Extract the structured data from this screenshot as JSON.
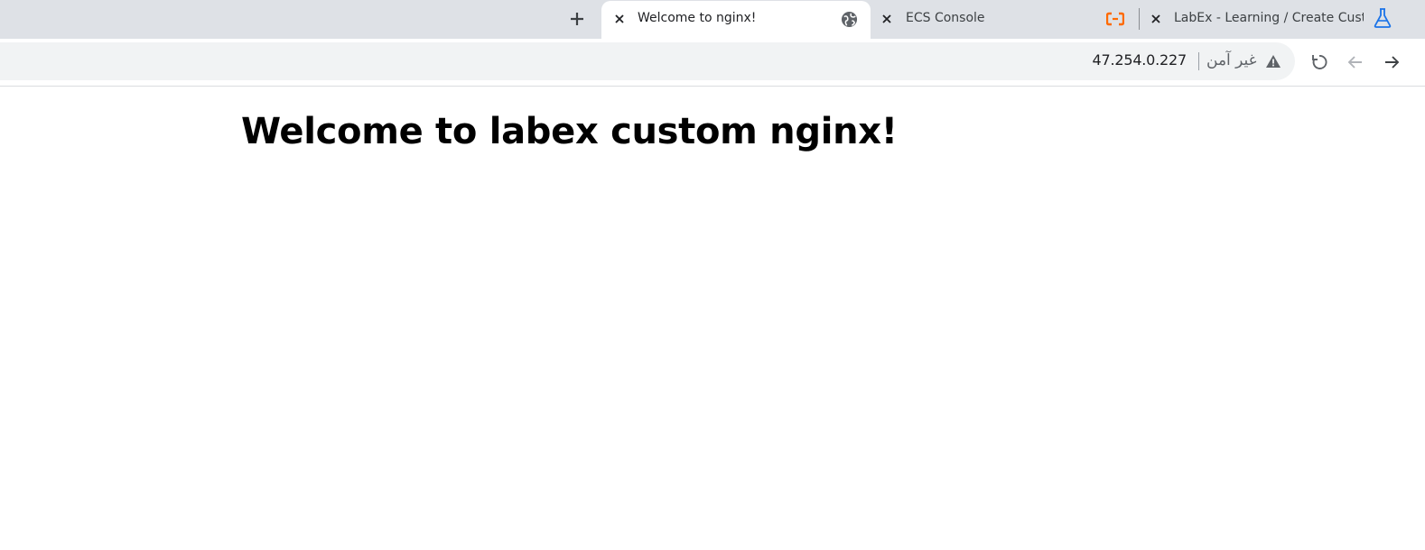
{
  "browser": {
    "tabs": [
      {
        "title": "Welcome to nginx!",
        "active": true,
        "favicon": "globe-icon"
      },
      {
        "title": "ECS Console",
        "active": false,
        "favicon": "alibaba-cloud-icon"
      },
      {
        "title": "LabEx - Learning / Create Custom",
        "active": false,
        "favicon": "flask-icon"
      }
    ],
    "address_bar": {
      "url": "47.254.0.227",
      "security_label": "غير آمن",
      "security_icon": "warning-icon"
    }
  },
  "page": {
    "heading": "Welcome to labex custom nginx!"
  },
  "colors": {
    "tabstrip_bg": "#dee1e6",
    "omnibox_bg": "#f1f3f4",
    "alibaba_orange": "#ff6a00",
    "labex_blue": "#1a73e8"
  }
}
